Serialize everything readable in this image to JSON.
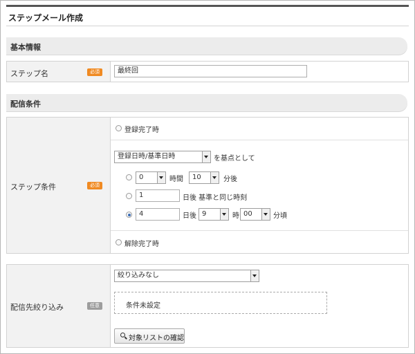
{
  "page": {
    "title": "ステップメール作成"
  },
  "sections": {
    "basic": "基本情報",
    "delivery": "配信条件"
  },
  "step_name": {
    "label": "ステップ名",
    "badge": "必須",
    "value": "最終回"
  },
  "step_condition": {
    "label": "ステップ条件",
    "badge": "必須",
    "radio_registered": "登録完了時",
    "base_select": "登録日時/基準日時",
    "base_suffix": "を基点として",
    "hours_value": "0",
    "hours_unit": "時間",
    "minutes_value": "10",
    "minutes_unit": "分後",
    "days_same_value": "1",
    "days_same_suffix": "日後 基準と同じ時刻",
    "days_value": "4",
    "days_unit": "日後",
    "hour_select": "9",
    "hour_unit": "時",
    "minute_select": "00",
    "minute_unit": "分頃",
    "selected_option": 3,
    "radio_unsubscribed": "解除完了時"
  },
  "filter": {
    "label": "配信先絞り込み",
    "badge": "任意",
    "select_value": "絞り込みなし",
    "condition_text": "条件未設定",
    "button_label": "対象リストの確認",
    "button_icon": "search-icon"
  }
}
